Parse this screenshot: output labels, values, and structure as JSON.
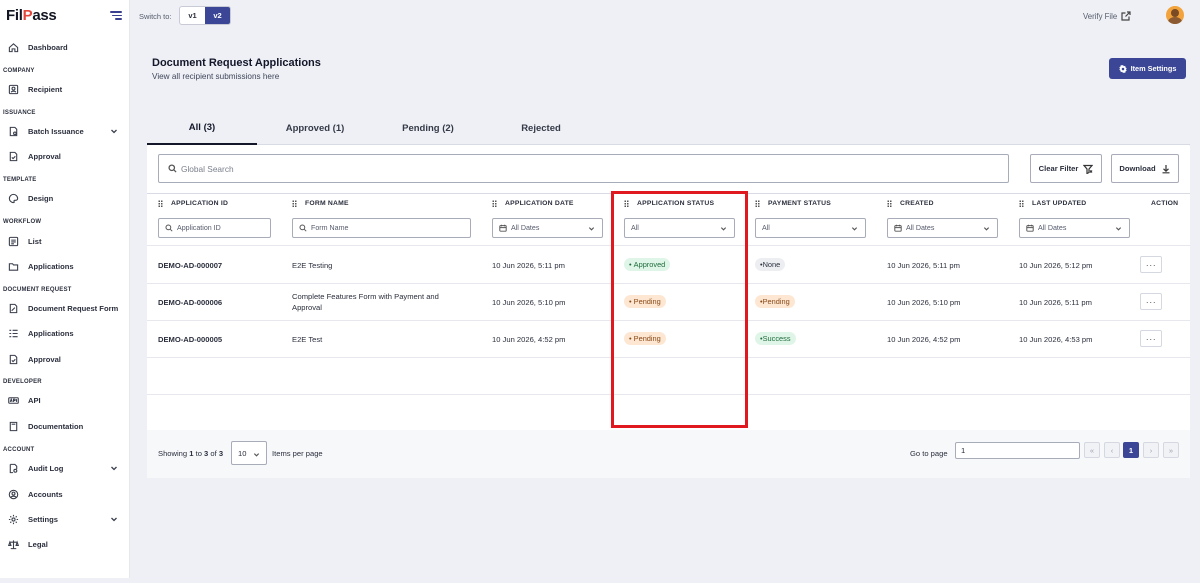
{
  "app": {
    "logo_a": "Fil",
    "logo_b": "P",
    "logo_c": "ass"
  },
  "sidebar": {
    "items": [
      {
        "label": "Dashboard",
        "icon": "home-icon"
      },
      {
        "label": "Recipient",
        "icon": "user-card-icon"
      },
      {
        "label": "Batch Issuance",
        "icon": "document-gear-icon"
      },
      {
        "label": "Approval",
        "icon": "document-check-icon"
      },
      {
        "label": "Design",
        "icon": "palette-icon"
      },
      {
        "label": "List",
        "icon": "list-box-icon"
      },
      {
        "label": "Applications",
        "icon": "folder-icon"
      },
      {
        "label": "Document Request Form",
        "icon": "document-edit-icon"
      },
      {
        "label": "Applications",
        "icon": "checklist-icon"
      },
      {
        "label": "Approval",
        "icon": "document-check-icon"
      },
      {
        "label": "API",
        "icon": "api-icon"
      },
      {
        "label": "Documentation",
        "icon": "book-icon"
      },
      {
        "label": "Audit Log",
        "icon": "document-search-icon"
      },
      {
        "label": "Accounts",
        "icon": "user-circle-icon"
      },
      {
        "label": "Settings",
        "icon": "gear-icon"
      },
      {
        "label": "Legal",
        "icon": "scale-icon"
      }
    ],
    "sections": [
      "COMPANY",
      "ISSUANCE",
      "TEMPLATE",
      "WORKFLOW",
      "DOCUMENT REQUEST",
      "DEVELOPER",
      "ACCOUNT"
    ]
  },
  "topbar": {
    "switch_label": "Switch to:",
    "v1": "v1",
    "v2": "v2",
    "verify": "Verify File"
  },
  "header": {
    "title": "Document Request Applications",
    "subtitle": "View all recipient submissions here",
    "item_settings": "Item Settings"
  },
  "tabs": [
    "All (3)",
    "Approved (1)",
    "Pending (2)",
    "Rejected"
  ],
  "toolbar": {
    "search_placeholder": "Global Search",
    "clear_filter": "Clear Filter",
    "download": "Download"
  },
  "columns": [
    "APPLICATION ID",
    "FORM NAME",
    "APPLICATION DATE",
    "APPLICATION STATUS",
    "PAYMENT STATUS",
    "CREATED",
    "LAST UPDATED",
    "ACTION"
  ],
  "filters": {
    "app_id": "Application ID",
    "form_name": "Form Name",
    "app_date": "All Dates",
    "app_status": "All",
    "payment_status": "All",
    "created": "All Dates",
    "last_updated": "All Dates"
  },
  "rows": [
    {
      "id": "DEMO-AD-000007",
      "form": "E2E Testing",
      "form2": "",
      "date": "10 Jun 2026, 5:11 pm",
      "status": "Approved",
      "payment": "None",
      "created": "10 Jun 2026, 5:11 pm",
      "updated": "10 Jun 2026, 5:12 pm",
      "action": "···"
    },
    {
      "id": "DEMO-AD-000006",
      "form": "Complete Features Form with Payment and",
      "form2": "Approval",
      "date": "10 Jun 2026, 5:10 pm",
      "status": "Pending",
      "payment": "Pending",
      "created": "10 Jun 2026, 5:10 pm",
      "updated": "10 Jun 2026, 5:11 pm",
      "action": "···"
    },
    {
      "id": "DEMO-AD-000005",
      "form": "E2E Test",
      "form2": "",
      "date": "10 Jun 2026, 4:52 pm",
      "status": "Pending",
      "payment": "Success",
      "created": "10 Jun 2026, 4:52 pm",
      "updated": "10 Jun 2026, 4:53 pm",
      "action": "···"
    }
  ],
  "pagination": {
    "showing_a": "Showing ",
    "from": "1",
    "to_word": " to ",
    "to": "3",
    "of_word": " of ",
    "total": "3",
    "per_page": "10",
    "per_page_label": "Items per page",
    "goto_label": "Go to page",
    "goto_value": "1",
    "first": "«",
    "prev": "‹",
    "current": "1",
    "next": "›",
    "last": "»"
  },
  "colors": {
    "accent": "#3b4796",
    "highlight": "#e0181f",
    "approved_bg": "#dff5e8",
    "pending_bg": "#fde7d2"
  }
}
